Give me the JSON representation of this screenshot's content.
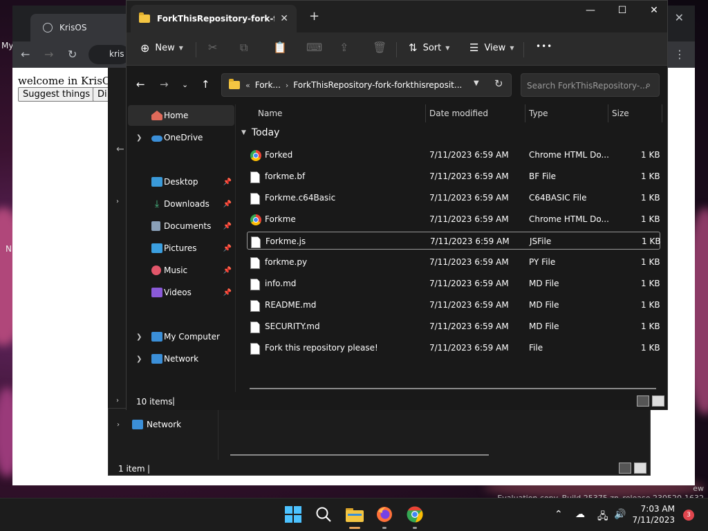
{
  "desktop": {
    "left_texts": [
      "My",
      "N"
    ],
    "watermark": "Evaluation copy. Build 25375.zn_release.230520-1632",
    "watermark_prefix": "ew"
  },
  "browser": {
    "tab_title": "KrisOS",
    "omnibox_text": "kris",
    "welcome": "welcome in KrisOS!",
    "buttons": [
      "Suggest things",
      "Di"
    ]
  },
  "explorer_back": {
    "nav_network": "Network",
    "status": "1 item"
  },
  "explorer": {
    "tab_title": "ForkThisRepository-fork-forkthisrepository",
    "command_bar": {
      "new_label": "New",
      "sort_label": "Sort",
      "view_label": "View",
      "more_label": "•••"
    },
    "address": {
      "segments": [
        "Fork...",
        "ForkThisRepository-fork-forkthisreposit..."
      ]
    },
    "search_placeholder": "Search ForkThisRepository-...",
    "nav_pane": [
      {
        "label": "Home",
        "selected": true
      },
      {
        "label": "OneDrive",
        "expandable": true
      },
      {
        "label": "Desktop",
        "pinned": true
      },
      {
        "label": "Downloads",
        "pinned": true
      },
      {
        "label": "Documents",
        "pinned": true
      },
      {
        "label": "Pictures",
        "pinned": true
      },
      {
        "label": "Music",
        "pinned": true
      },
      {
        "label": "Videos",
        "pinned": true
      },
      {
        "label": "My Computer",
        "expandable": true
      },
      {
        "label": "Network",
        "expandable": true
      }
    ],
    "columns": [
      "Name",
      "Date modified",
      "Type",
      "Size"
    ],
    "group_label": "Today",
    "files": [
      {
        "name": "Forked",
        "date": "7/11/2023 6:59 AM",
        "type": "Chrome HTML Do...",
        "size": "1 KB",
        "icon": "chrome-icon"
      },
      {
        "name": "forkme.bf",
        "date": "7/11/2023 6:59 AM",
        "type": "BF File",
        "size": "1 KB",
        "icon": "file-icon"
      },
      {
        "name": "Forkme.c64Basic",
        "date": "7/11/2023 6:59 AM",
        "type": "C64BASIC File",
        "size": "1 KB",
        "icon": "file-icon"
      },
      {
        "name": "Forkme",
        "date": "7/11/2023 6:59 AM",
        "type": "Chrome HTML Do...",
        "size": "1 KB",
        "icon": "chrome-icon"
      },
      {
        "name": "Forkme.js",
        "date": "7/11/2023 6:59 AM",
        "type": "JSFile",
        "size": "1 KB",
        "icon": "file-icon",
        "selected": true
      },
      {
        "name": "forkme.py",
        "date": "7/11/2023 6:59 AM",
        "type": "PY File",
        "size": "1 KB",
        "icon": "file-icon"
      },
      {
        "name": "info.md",
        "date": "7/11/2023 6:59 AM",
        "type": "MD File",
        "size": "1 KB",
        "icon": "file-icon"
      },
      {
        "name": "README.md",
        "date": "7/11/2023 6:59 AM",
        "type": "MD File",
        "size": "1 KB",
        "icon": "file-icon"
      },
      {
        "name": "SECURITY.md",
        "date": "7/11/2023 6:59 AM",
        "type": "MD File",
        "size": "1 KB",
        "icon": "file-icon"
      },
      {
        "name": "Fork this repository please!",
        "date": "7/11/2023 6:59 AM",
        "type": "File",
        "size": "1 KB",
        "icon": "file-icon"
      }
    ],
    "status": "10 items"
  },
  "taskbar": {
    "time": "7:03 AM",
    "date": "7/11/2023",
    "notification_count": "3"
  },
  "colors": {
    "explorer_bg": "#191919",
    "accent_folder": "#f4c542",
    "taskbar_bg": "#1c1c1c",
    "badge": "#e0464e"
  }
}
